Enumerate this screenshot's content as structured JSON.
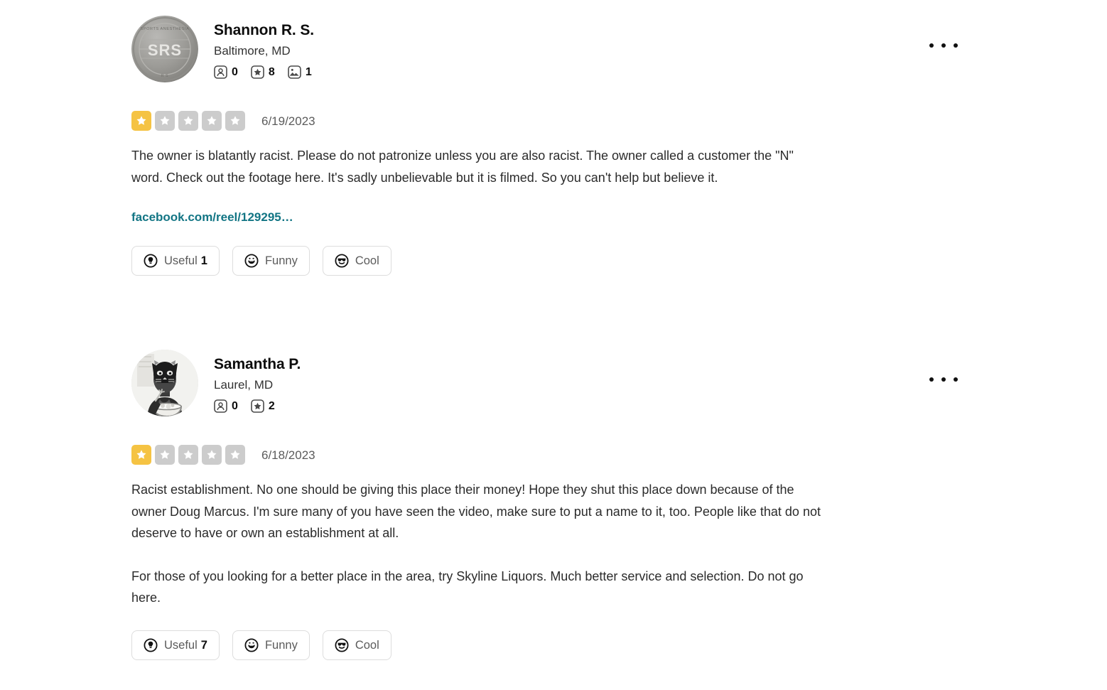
{
  "page": {
    "title": "Yelp business reviews list",
    "colors": {
      "star_filled": "#f5c343",
      "star_empty": "#cccccc",
      "link": "#127584",
      "body_text": "#2b2b2b",
      "muted_text": "#5b5b5b",
      "background": "#ffffff",
      "button_border": "#dddddd"
    }
  },
  "reviews": [
    {
      "user": {
        "name": "Shannon R. S.",
        "location": "Baltimore, MD",
        "avatar_alt": "SRS silver coin medallion avatar",
        "stats": [
          {
            "icon": "friends-icon",
            "label": "friends",
            "value": "0"
          },
          {
            "icon": "reviews-star-icon",
            "label": "reviews",
            "value": "8"
          },
          {
            "icon": "photos-icon",
            "label": "photos",
            "value": "1"
          }
        ]
      },
      "rating": 1,
      "rating_max": 5,
      "date": "6/19/2023",
      "paragraphs": [
        "The owner is blatantly racist. Please do not patronize unless you are also racist. The owner called a customer the \"N\" word. Check out the footage here. It's sadly unbelievable but it is filmed. So you can't help but believe it."
      ],
      "link": "facebook.com/reel/129295…",
      "actions": [
        {
          "icon": "useful-bulb-icon",
          "label": "Useful",
          "count": "1"
        },
        {
          "icon": "funny-smile-icon",
          "label": "Funny",
          "count": ""
        },
        {
          "icon": "cool-sunglasses-icon",
          "label": "Cool",
          "count": ""
        }
      ],
      "more_menu_label": "More options"
    },
    {
      "user": {
        "name": "Samantha P.",
        "location": "Laurel, MD",
        "avatar_alt": "Illustration of a person wearing a cat mask eating from a bowl",
        "stats": [
          {
            "icon": "friends-icon",
            "label": "friends",
            "value": "0"
          },
          {
            "icon": "reviews-star-icon",
            "label": "reviews",
            "value": "2"
          }
        ]
      },
      "rating": 1,
      "rating_max": 5,
      "date": "6/18/2023",
      "paragraphs": [
        "Racist establishment. No one should be giving this place their money! Hope they shut this place down because of the owner Doug Marcus. I'm sure many of you have seen the video, make sure to put a name to it, too. People like that do not deserve to have or own an establishment at all.",
        "For those of you looking for a better place in the area, try Skyline Liquors. Much better service and selection. Do not go here."
      ],
      "link": "",
      "actions": [
        {
          "icon": "useful-bulb-icon",
          "label": "Useful",
          "count": "7"
        },
        {
          "icon": "funny-smile-icon",
          "label": "Funny",
          "count": ""
        },
        {
          "icon": "cool-sunglasses-icon",
          "label": "Cool",
          "count": ""
        }
      ],
      "more_menu_label": "More options"
    }
  ]
}
